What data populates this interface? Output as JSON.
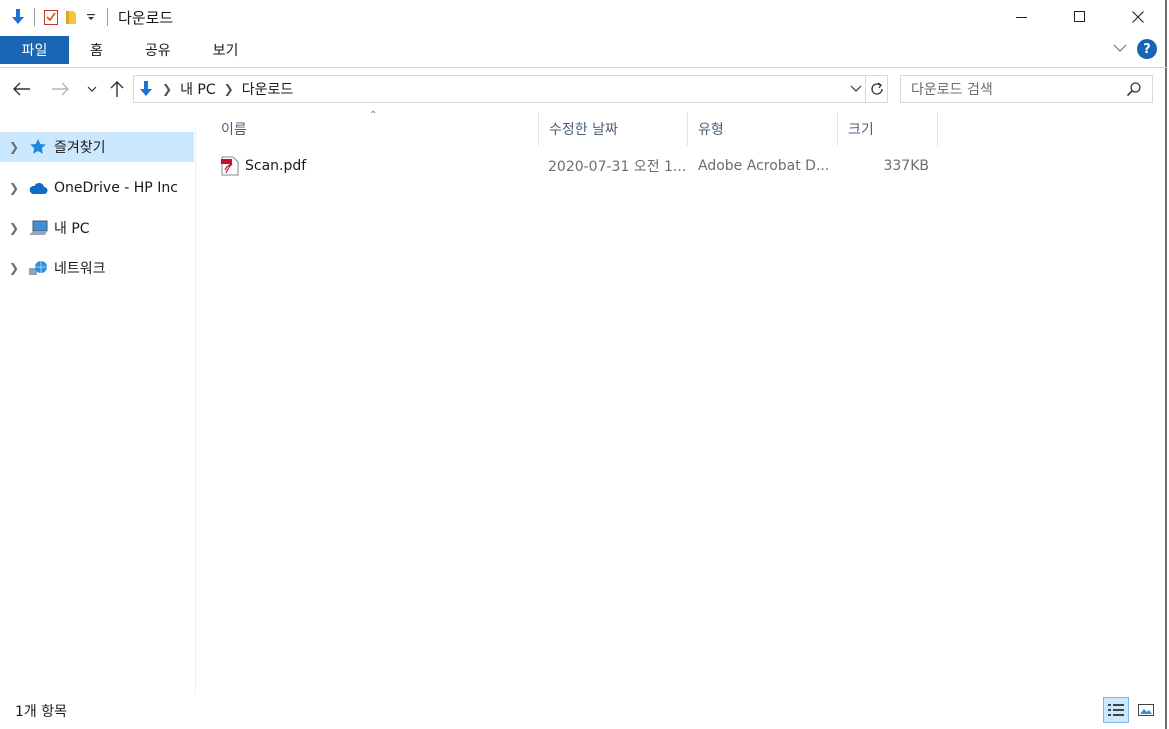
{
  "window": {
    "title": "다운로드",
    "controls": {
      "minimize": "minimize",
      "maximize": "maximize",
      "close": "close"
    }
  },
  "ribbon": {
    "file_tab": "파일",
    "tabs": [
      "홈",
      "공유",
      "보기"
    ],
    "help": "?"
  },
  "nav": {
    "breadcrumb": [
      "내 PC",
      "다운로드"
    ],
    "search_placeholder": "다운로드 검색"
  },
  "sidebar": {
    "items": [
      {
        "label": "즐겨찾기",
        "icon": "star-icon"
      },
      {
        "label": "OneDrive - HP Inc",
        "icon": "cloud-icon"
      },
      {
        "label": "내 PC",
        "icon": "computer-icon"
      },
      {
        "label": "네트워크",
        "icon": "network-icon"
      }
    ]
  },
  "columns": [
    "이름",
    "수정한 날짜",
    "유형",
    "크기"
  ],
  "files": [
    {
      "name": "Scan.pdf",
      "date": "2020-07-31 오전 1...",
      "type": "Adobe Acrobat D...",
      "size": "337KB",
      "icon": "pdf-icon"
    }
  ],
  "status": {
    "count": "1개 항목"
  },
  "colors": {
    "accent": "#1a64b4",
    "selection": "#cce8ff"
  }
}
